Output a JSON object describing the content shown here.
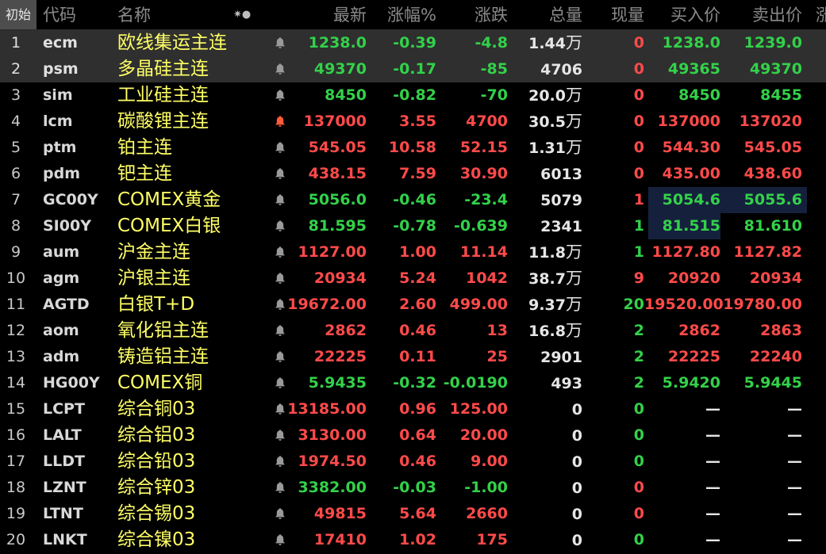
{
  "colors": {
    "up": "#ff4a4a",
    "down": "#33d14a",
    "flat": "#e6e6e6",
    "name": "#ffff66",
    "selected_row": "#2f2f2f",
    "highlight": "#15213c"
  },
  "header": {
    "init": "初始",
    "code": "代码",
    "name": "名称",
    "icons": "✷●",
    "last": "最新",
    "pct": "涨幅%",
    "chg": "涨跌",
    "vol": "总量",
    "cur": "现量",
    "bid": "买入价",
    "ask": "卖出价",
    "more": "涨"
  },
  "rows": [
    {
      "num": "1",
      "code": "ecm",
      "name": "欧线集运主连",
      "bell": "gray",
      "last": "1238.0",
      "pct": "-0.39",
      "chg": "-4.8",
      "vol": "1.44",
      "unit": "万",
      "cur": "0",
      "bid": "1238.0",
      "ask": "1239.0",
      "dir": "dn",
      "curdir": "up",
      "biddir": "dn",
      "askdir": "dn",
      "sel": true
    },
    {
      "num": "2",
      "code": "psm",
      "name": "多晶硅主连",
      "bell": "gray",
      "last": "49370",
      "pct": "-0.17",
      "chg": "-85",
      "vol": "4706",
      "unit": "",
      "cur": "0",
      "bid": "49365",
      "ask": "49370",
      "dir": "dn",
      "curdir": "up",
      "biddir": "dn",
      "askdir": "dn",
      "sel": true
    },
    {
      "num": "3",
      "code": "sim",
      "name": "工业硅主连",
      "bell": "gray",
      "last": "8450",
      "pct": "-0.82",
      "chg": "-70",
      "vol": "20.0",
      "unit": "万",
      "cur": "0",
      "bid": "8450",
      "ask": "8455",
      "dir": "dn",
      "curdir": "up",
      "biddir": "dn",
      "askdir": "dn"
    },
    {
      "num": "4",
      "code": "lcm",
      "name": "碳酸锂主连",
      "bell": "red",
      "last": "137000",
      "pct": "3.55",
      "chg": "4700",
      "vol": "30.5",
      "unit": "万",
      "cur": "0",
      "bid": "137000",
      "ask": "137020",
      "dir": "up",
      "curdir": "up",
      "biddir": "up",
      "askdir": "up"
    },
    {
      "num": "5",
      "code": "ptm",
      "name": "铂主连",
      "bell": "gray",
      "last": "545.05",
      "pct": "10.58",
      "chg": "52.15",
      "vol": "1.31",
      "unit": "万",
      "cur": "0",
      "bid": "544.30",
      "ask": "545.05",
      "dir": "up",
      "curdir": "up",
      "biddir": "up",
      "askdir": "up"
    },
    {
      "num": "6",
      "code": "pdm",
      "name": "钯主连",
      "bell": "gray",
      "last": "438.15",
      "pct": "7.59",
      "chg": "30.90",
      "vol": "6013",
      "unit": "",
      "cur": "0",
      "bid": "435.00",
      "ask": "438.60",
      "dir": "up",
      "curdir": "up",
      "biddir": "up",
      "askdir": "up"
    },
    {
      "num": "7",
      "code": "GC00Y",
      "name": "COMEX黄金",
      "bell": "gray",
      "last": "5056.0",
      "pct": "-0.46",
      "chg": "-23.4",
      "vol": "5079",
      "unit": "",
      "cur": "1",
      "bid": "5054.6",
      "ask": "5055.6",
      "dir": "dn",
      "curdir": "up",
      "biddir": "dn",
      "askdir": "dn",
      "hlbid": true,
      "hlask": true
    },
    {
      "num": "8",
      "code": "SI00Y",
      "name": "COMEX白银",
      "bell": "gray",
      "last": "81.595",
      "pct": "-0.78",
      "chg": "-0.639",
      "vol": "2341",
      "unit": "",
      "cur": "1",
      "bid": "81.515",
      "ask": "81.610",
      "dir": "dn",
      "curdir": "dn",
      "biddir": "dn",
      "askdir": "dn",
      "hlbid": true
    },
    {
      "num": "9",
      "code": "aum",
      "name": "沪金主连",
      "bell": "gray",
      "last": "1127.00",
      "pct": "1.00",
      "chg": "11.14",
      "vol": "11.8",
      "unit": "万",
      "cur": "1",
      "bid": "1127.80",
      "ask": "1127.82",
      "dir": "up",
      "curdir": "dn",
      "biddir": "up",
      "askdir": "up"
    },
    {
      "num": "10",
      "code": "agm",
      "name": "沪银主连",
      "bell": "gray",
      "last": "20934",
      "pct": "5.24",
      "chg": "1042",
      "vol": "38.7",
      "unit": "万",
      "cur": "9",
      "bid": "20920",
      "ask": "20934",
      "dir": "up",
      "curdir": "up",
      "biddir": "up",
      "askdir": "up"
    },
    {
      "num": "11",
      "code": "AGTD",
      "name": "白银T+D",
      "bell": "gray",
      "last": "19672.00",
      "pct": "2.60",
      "chg": "499.00",
      "vol": "9.37",
      "unit": "万",
      "cur": "20",
      "bid": "19520.00",
      "ask": "19780.00",
      "dir": "up",
      "curdir": "dn",
      "biddir": "up",
      "askdir": "up"
    },
    {
      "num": "12",
      "code": "aom",
      "name": "氧化铝主连",
      "bell": "gray",
      "last": "2862",
      "pct": "0.46",
      "chg": "13",
      "vol": "16.8",
      "unit": "万",
      "cur": "2",
      "bid": "2862",
      "ask": "2863",
      "dir": "up",
      "curdir": "dn",
      "biddir": "up",
      "askdir": "up"
    },
    {
      "num": "13",
      "code": "adm",
      "name": "铸造铝主连",
      "bell": "gray",
      "last": "22225",
      "pct": "0.11",
      "chg": "25",
      "vol": "2901",
      "unit": "",
      "cur": "2",
      "bid": "22225",
      "ask": "22240",
      "dir": "up",
      "curdir": "dn",
      "biddir": "up",
      "askdir": "up"
    },
    {
      "num": "14",
      "code": "HG00Y",
      "name": "COMEX铜",
      "bell": "gray",
      "last": "5.9435",
      "pct": "-0.32",
      "chg": "-0.0190",
      "vol": "493",
      "unit": "",
      "cur": "2",
      "bid": "5.9420",
      "ask": "5.9445",
      "dir": "dn",
      "curdir": "dn",
      "biddir": "dn",
      "askdir": "dn"
    },
    {
      "num": "15",
      "code": "LCPT",
      "name": "综合铜03",
      "bell": "gray",
      "last": "13185.00",
      "pct": "0.96",
      "chg": "125.00",
      "vol": "0",
      "unit": "",
      "cur": "0",
      "bid": "—",
      "ask": "—",
      "dir": "up",
      "curdir": "dn",
      "biddir": "fl",
      "askdir": "fl"
    },
    {
      "num": "16",
      "code": "LALT",
      "name": "综合铝03",
      "bell": "gray",
      "last": "3130.00",
      "pct": "0.64",
      "chg": "20.00",
      "vol": "0",
      "unit": "",
      "cur": "0",
      "bid": "—",
      "ask": "—",
      "dir": "up",
      "curdir": "dn",
      "biddir": "fl",
      "askdir": "fl"
    },
    {
      "num": "17",
      "code": "LLDT",
      "name": "综合铅03",
      "bell": "gray",
      "last": "1974.50",
      "pct": "0.46",
      "chg": "9.00",
      "vol": "0",
      "unit": "",
      "cur": "0",
      "bid": "—",
      "ask": "—",
      "dir": "up",
      "curdir": "dn",
      "biddir": "fl",
      "askdir": "fl"
    },
    {
      "num": "18",
      "code": "LZNT",
      "name": "综合锌03",
      "bell": "gray",
      "last": "3382.00",
      "pct": "-0.03",
      "chg": "-1.00",
      "vol": "0",
      "unit": "",
      "cur": "0",
      "bid": "—",
      "ask": "—",
      "dir": "dn",
      "curdir": "up",
      "biddir": "fl",
      "askdir": "fl"
    },
    {
      "num": "19",
      "code": "LTNT",
      "name": "综合锡03",
      "bell": "gray",
      "last": "49815",
      "pct": "5.64",
      "chg": "2660",
      "vol": "0",
      "unit": "",
      "cur": "0",
      "bid": "—",
      "ask": "—",
      "dir": "up",
      "curdir": "up",
      "biddir": "fl",
      "askdir": "fl"
    },
    {
      "num": "20",
      "code": "LNKT",
      "name": "综合镍03",
      "bell": "gray",
      "last": "17410",
      "pct": "1.02",
      "chg": "175",
      "vol": "0",
      "unit": "",
      "cur": "0",
      "bid": "—",
      "ask": "—",
      "dir": "up",
      "curdir": "dn",
      "biddir": "fl",
      "askdir": "fl"
    }
  ]
}
